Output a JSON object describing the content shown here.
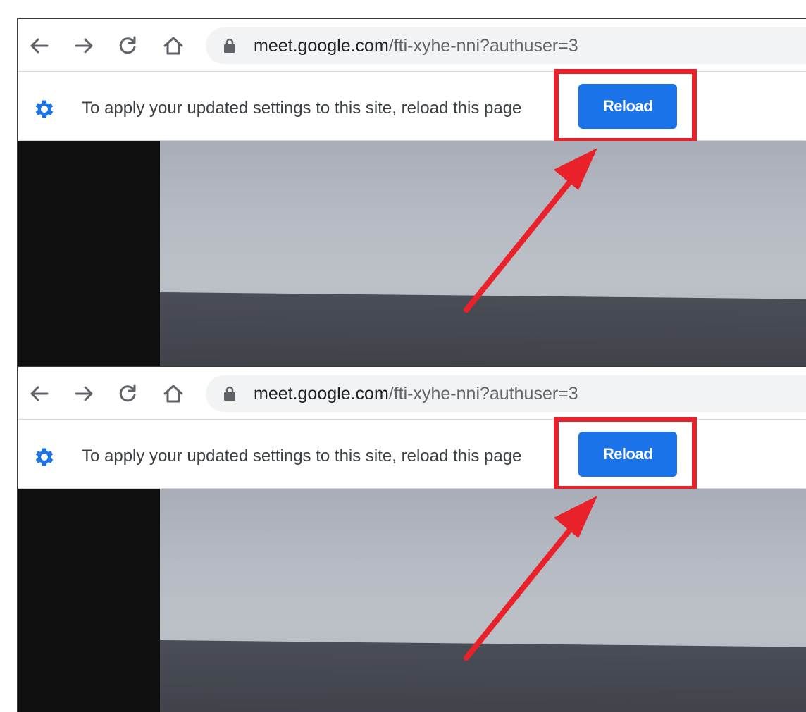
{
  "browser": {
    "url_host": "meet.google.com",
    "url_path": "/fti-xyhe-nni?authuser=3"
  },
  "infobar": {
    "message": "To apply your updated settings to this site, reload this page",
    "reload_label": "Reload"
  },
  "colors": {
    "accent": "#1a73e8",
    "annotation": "#e8212b"
  },
  "icons": [
    "back-arrow-icon",
    "forward-arrow-icon",
    "reload-icon",
    "home-icon",
    "lock-icon",
    "gear-icon"
  ]
}
